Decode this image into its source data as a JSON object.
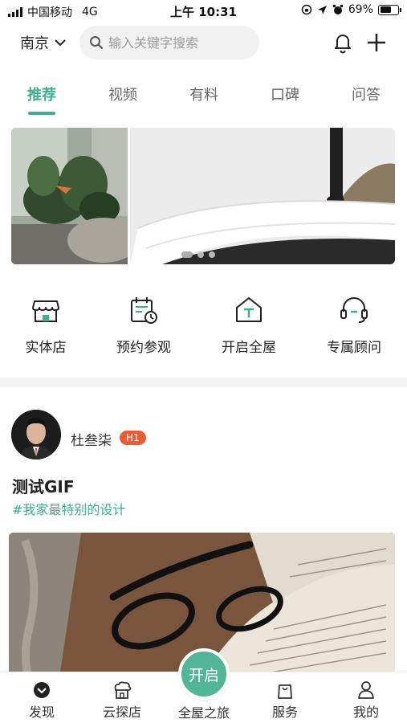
{
  "status_bar": {
    "carrier": "中国移动",
    "network": "4G",
    "time": "上午 10:31",
    "battery": "69%",
    "battery_level": 0.69
  },
  "header": {
    "city": "南京",
    "search_placeholder": "输入关键字搜索"
  },
  "tabs": [
    {
      "label": "推荐",
      "active": true
    },
    {
      "label": "视频",
      "active": false
    },
    {
      "label": "有料",
      "active": false
    },
    {
      "label": "口碑",
      "active": false
    },
    {
      "label": "问答",
      "active": false
    }
  ],
  "banner": {
    "page_count": 3,
    "current_page": 1
  },
  "quick_entries": [
    {
      "label": "实体店",
      "icon": "store-icon"
    },
    {
      "label": "预约参观",
      "icon": "calendar-clock-icon"
    },
    {
      "label": "开启全屋",
      "icon": "house-t-icon"
    },
    {
      "label": "专属顾问",
      "icon": "headset-icon"
    }
  ],
  "post": {
    "author": "杜叁柒",
    "level": "H1",
    "title": "测试GIF",
    "tag": "#我家最特别的设计"
  },
  "bottom_nav": {
    "items": [
      {
        "label": "发现",
        "icon": "discover-icon",
        "active": true
      },
      {
        "label": "云探店",
        "icon": "cloud-store-icon",
        "active": false
      },
      {
        "label": "全屋之旅",
        "icon": "open-button",
        "active": false
      },
      {
        "label": "服务",
        "icon": "shopping-bag-icon",
        "active": false
      },
      {
        "label": "我的",
        "icon": "user-icon",
        "active": false
      }
    ],
    "center_button": "开启"
  },
  "colors": {
    "accent": "#3fae8e",
    "badge": "#f05a32",
    "center_button": "#52b696"
  }
}
